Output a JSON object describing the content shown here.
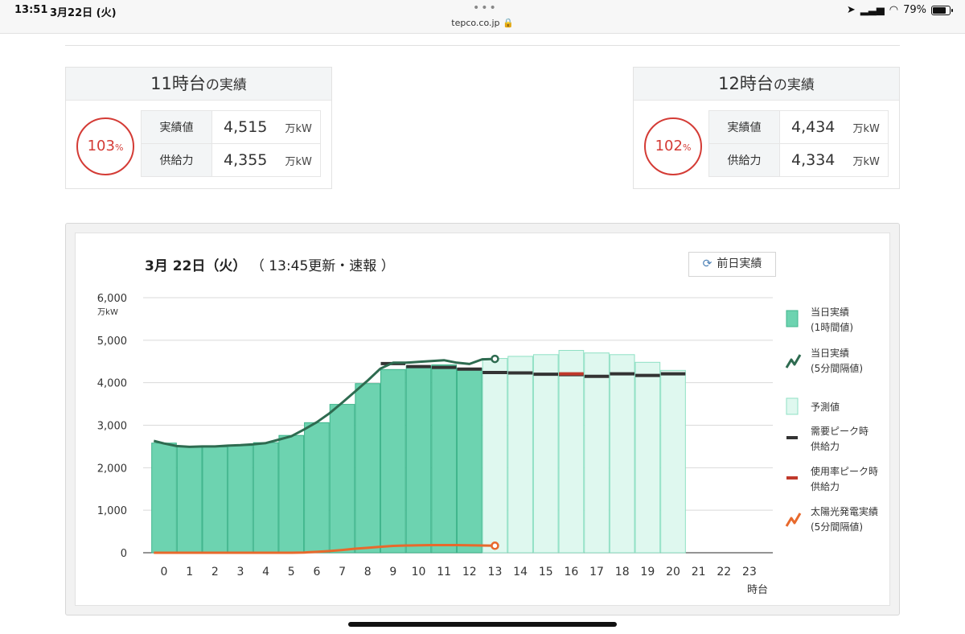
{
  "status": {
    "time": "13:51",
    "date": "3月22日 (火)",
    "url": "tepco.co.jp 🔒",
    "battery": "79%",
    "battery_level": 0.79
  },
  "cards": [
    {
      "title": "11時台",
      "title_suffix": "の実績",
      "percent": "103",
      "percent_sign": "%",
      "rows": [
        {
          "label": "実績値",
          "value": "4,515",
          "unit": "万kW"
        },
        {
          "label": "供給力",
          "value": "4,355",
          "unit": "万kW"
        }
      ]
    },
    {
      "title": "12時台",
      "title_suffix": "の実績",
      "percent": "102",
      "percent_sign": "%",
      "rows": [
        {
          "label": "実績値",
          "value": "4,434",
          "unit": "万kW"
        },
        {
          "label": "供給力",
          "value": "4,334",
          "unit": "万kW"
        }
      ]
    }
  ],
  "chart_header": {
    "date": "3月 22日（火）",
    "update": "（ 13:45更新・速報 ）",
    "prev_button": "前日実績"
  },
  "chart_data": {
    "type": "bar",
    "ylabel": "万kW",
    "xlabel": "時台",
    "ylim": [
      0,
      6000
    ],
    "yticks": [
      0,
      1000,
      2000,
      3000,
      4000,
      5000,
      6000
    ],
    "ytick_labels": [
      "0",
      "1,000",
      "2,000",
      "3,000",
      "4,000",
      "5,000",
      "6,000"
    ],
    "categories": [
      "0",
      "1",
      "2",
      "3",
      "4",
      "5",
      "6",
      "7",
      "8",
      "9",
      "10",
      "11",
      "12",
      "13",
      "14",
      "15",
      "16",
      "17",
      "18",
      "19",
      "20",
      "21",
      "22",
      "23"
    ],
    "grid": true,
    "legend_position": "right",
    "series": [
      {
        "name": "当日実績\n(1時間値)",
        "kind": "bar",
        "color": "#6dd3b0",
        "stroke": "#3fb58c",
        "values": [
          2580,
          2500,
          2490,
          2520,
          2590,
          2760,
          3060,
          3490,
          3980,
          4310,
          4390,
          4420,
          4340,
          null,
          null,
          null,
          null,
          null,
          null,
          null,
          null,
          null,
          null,
          null
        ]
      },
      {
        "name": "予測値",
        "kind": "bar",
        "color": "#dff8ef",
        "stroke": "#8fe0c4",
        "values": [
          null,
          null,
          null,
          null,
          null,
          null,
          null,
          null,
          null,
          null,
          null,
          null,
          null,
          4570,
          4620,
          4660,
          4760,
          4700,
          4660,
          4480,
          4290,
          null,
          null,
          null
        ]
      },
      {
        "name": "需要ピーク時\n供給力",
        "kind": "step",
        "color": "#333333",
        "values": [
          null,
          null,
          null,
          null,
          null,
          null,
          null,
          null,
          null,
          4450,
          4380,
          4360,
          4320,
          4240,
          4230,
          4200,
          4190,
          4150,
          4210,
          4170,
          4210,
          null,
          null,
          null
        ]
      },
      {
        "name": "使用率ピーク時\n供給力",
        "kind": "step",
        "color": "#c0392b",
        "values": [
          null,
          null,
          null,
          null,
          null,
          null,
          null,
          null,
          null,
          null,
          null,
          null,
          null,
          null,
          null,
          null,
          4210,
          null,
          null,
          null,
          null,
          null,
          null,
          null
        ]
      },
      {
        "name": "当日実績\n(5分間隔値)",
        "kind": "line",
        "color": "#2e6b50",
        "x": [
          -0.4,
          0,
          0.5,
          1,
          1.5,
          2,
          2.5,
          3,
          3.5,
          4,
          4.5,
          5,
          5.5,
          6,
          6.5,
          7,
          7.5,
          8,
          8.5,
          9,
          9.5,
          10,
          10.5,
          11,
          11.5,
          12,
          12.5,
          13
        ],
        "y": [
          2630,
          2570,
          2510,
          2490,
          2500,
          2500,
          2520,
          2530,
          2550,
          2580,
          2660,
          2740,
          2900,
          3070,
          3280,
          3530,
          3790,
          4050,
          4330,
          4470,
          4470,
          4490,
          4510,
          4530,
          4470,
          4440,
          4550,
          4560
        ]
      },
      {
        "name": "太陽光発電実績\n(5分間隔値)",
        "kind": "line",
        "color": "#e8692c",
        "x": [
          -0.4,
          1,
          2,
          3,
          4,
          5,
          5.5,
          6,
          6.5,
          7,
          7.5,
          8,
          8.5,
          9,
          9.5,
          10,
          10.5,
          11,
          11.5,
          12,
          12.5,
          13
        ],
        "y": [
          0,
          0,
          0,
          0,
          0,
          0,
          5,
          20,
          40,
          65,
          95,
          115,
          140,
          160,
          170,
          175,
          180,
          180,
          180,
          175,
          170,
          165
        ]
      }
    ]
  }
}
